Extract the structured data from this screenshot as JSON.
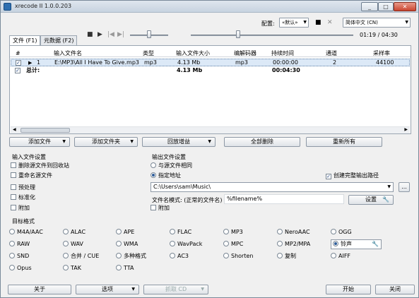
{
  "window": {
    "title": "xrecode II 1.0.0.203",
    "minimize": "_",
    "maximize": "□",
    "close": "✕"
  },
  "top": {
    "config_label": "配置:",
    "config_value": "«默认»",
    "lang_value": "简体中文 (CN)",
    "time": "01:19 / 04:30"
  },
  "tabs": [
    {
      "label": "文件 (F1)"
    },
    {
      "label": "元数据 (F2)"
    }
  ],
  "table": {
    "headers": [
      "#",
      "输入文件名",
      "类型",
      "输入文件大小",
      "编解码器",
      "持续时间",
      "通道",
      "采样率"
    ],
    "rows": [
      {
        "checked": true,
        "num": "1",
        "name": "E:\\MP3\\All I Have To Give.mp3",
        "type": "mp3",
        "size": "4.13 Mb",
        "codec": "mp3",
        "duration": "00:00:00",
        "channels": "2",
        "rate": "44100"
      }
    ],
    "total": {
      "label": "总计:",
      "size": "4.13 Mb",
      "duration": "00:04:30"
    }
  },
  "buttons": {
    "add_file": "添加文件",
    "add_folder": "添加文件夹",
    "replay_gain": "回放增益",
    "remove_all": "全部删除",
    "reset_all": "重新所有",
    "settings": "设置",
    "about": "关于",
    "options": "选项",
    "rip_cd": "抓取 CD",
    "start": "开始",
    "close": "关闭",
    "browse": "..."
  },
  "input_settings": {
    "title": "输入文件设置",
    "items": [
      {
        "label": "删除源文件到回收站",
        "checked": false
      },
      {
        "label": "重命名源文件",
        "checked": false
      },
      {
        "label": "预处理",
        "checked": false
      },
      {
        "label": "标准化",
        "checked": false
      },
      {
        "label": "附加",
        "checked": false
      }
    ]
  },
  "output_settings": {
    "title": "输出文件设置",
    "same_as_source": "与源文件相同",
    "specified": "指定地址",
    "create_full_path": "创建完整输出路径",
    "path": "C:\\Users\\sam\\Music\\",
    "filename_label": "文件名模式: (正常的文件名)",
    "filename_pattern": "%filename%",
    "append": "附加"
  },
  "target_format": {
    "title": "目标格式",
    "rows": [
      [
        "M4A/AAC",
        "ALAC",
        "APE",
        "FLAC",
        "MP3",
        "NeroAAC",
        "OGG"
      ],
      [
        "RAW",
        "WAV",
        "WMA",
        "WavPack",
        "MPC",
        "MP2/MPA",
        "铃声"
      ],
      [
        "SND",
        "合并 / CUE",
        "多种格式",
        "AC3",
        "Shorten",
        "复制",
        "AIFF"
      ],
      [
        "Opus",
        "TAK",
        "TTA"
      ]
    ],
    "selected": "铃声"
  }
}
